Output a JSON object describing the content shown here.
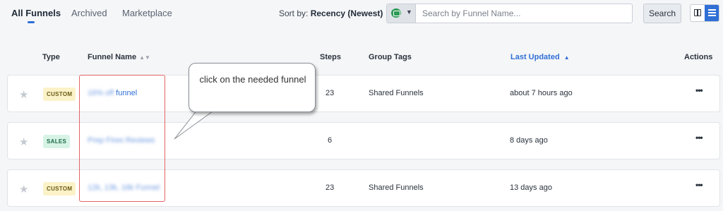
{
  "tabs": {
    "all_funnels": "All Funnels",
    "archived": "Archived",
    "marketplace": "Marketplace"
  },
  "sort": {
    "prefix": "Sort by:",
    "value": "Recency (Newest)"
  },
  "search": {
    "placeholder": "Search by Funnel Name...",
    "button": "Search"
  },
  "columns": {
    "type": "Type",
    "funnel_name": "Funnel Name",
    "steps": "Steps",
    "group_tags": "Group Tags",
    "last_updated": "Last Updated",
    "actions": "Actions"
  },
  "rows": [
    {
      "type": "CUSTOM",
      "name_hidden": "16% off",
      "name_visible": "funnel",
      "steps": "23",
      "tags": "Shared Funnels",
      "updated": "about 7 hours ago",
      "actions": "•••"
    },
    {
      "type": "SALES",
      "name_hidden": "Prep Fires Reviews",
      "name_visible": "",
      "steps": "6",
      "tags": "",
      "updated": "8 days ago",
      "actions": "•••"
    },
    {
      "type": "CUSTOM",
      "name_hidden": "12k, 13k, 16k Funnel",
      "name_visible": "",
      "steps": "23",
      "tags": "Shared Funnels",
      "updated": "13 days ago",
      "actions": "•••"
    }
  ],
  "annotation": {
    "callout_text": "click on the needed funnel"
  },
  "colors": {
    "accent": "#2f6fd6",
    "highlight": "#e36565",
    "custom_badge_bg": "#fbf2c8",
    "sales_badge_bg": "#d6f3e6"
  },
  "icons": {
    "filter": "chat-filter-icon",
    "grid_view": "grid-view-icon",
    "list_view": "list-view-icon",
    "favorite": "star-icon",
    "menu": "more-horizontal-icon"
  }
}
